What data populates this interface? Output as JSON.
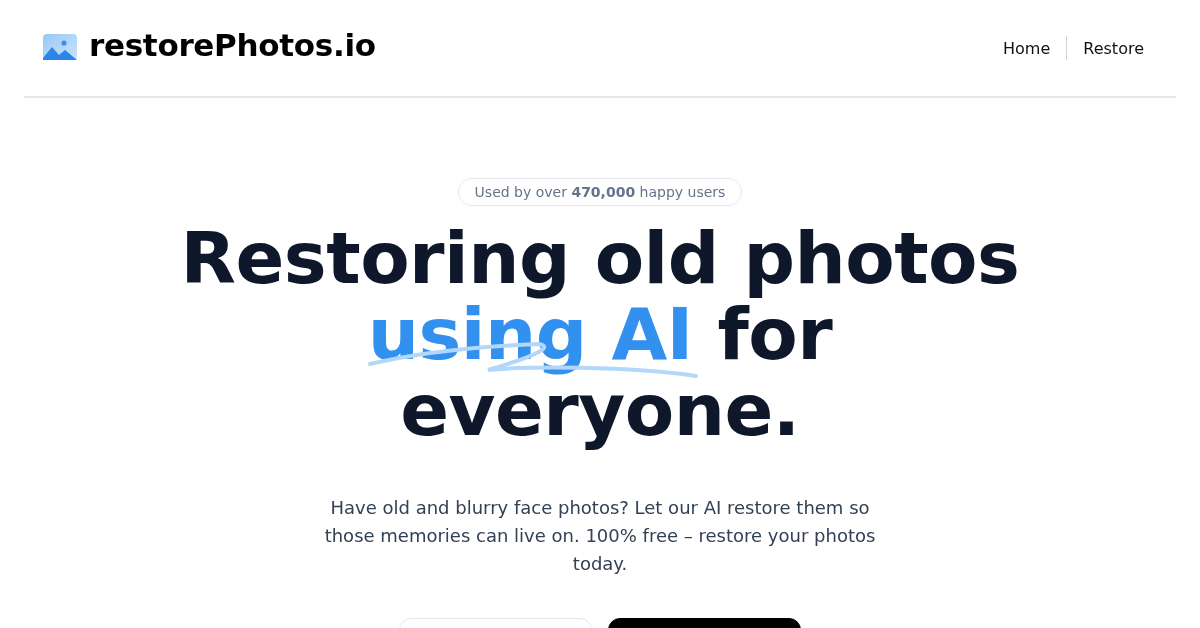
{
  "header": {
    "logo_text": "restorePhotos.io",
    "nav": [
      {
        "label": "Home"
      },
      {
        "label": "Restore"
      }
    ]
  },
  "badge": "Used by over **470,000** happy users",
  "headline": {
    "before": "Restoring old photos",
    "highlight": "using AI",
    "after": "for everyone."
  },
  "description": "Have old and blurry face photos? Let our AI restore them so those memories can live on. 100% free – restore your photos today.",
  "buttons": [
    {
      "kind": "outline"
    },
    {
      "kind": "dark"
    }
  ]
}
